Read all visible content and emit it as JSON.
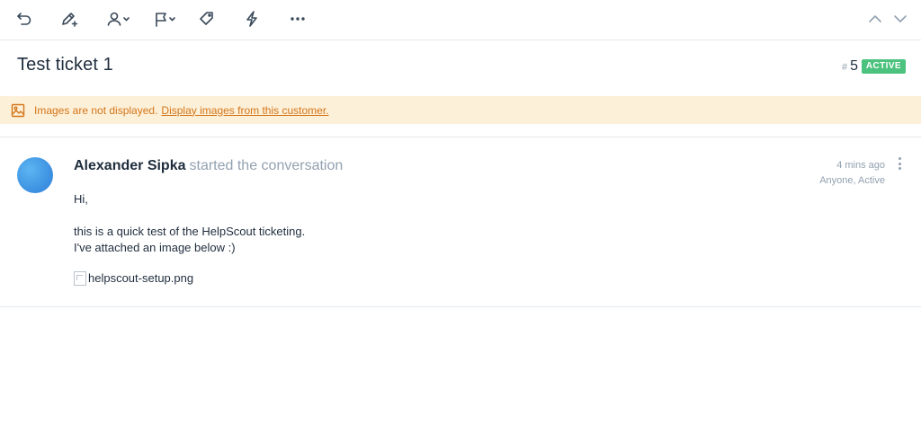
{
  "toolbar": {
    "icons": [
      "undo-icon",
      "edit-note-icon",
      "assign-user-icon",
      "status-flag-icon",
      "tag-icon",
      "workflow-icon",
      "more-icon",
      "previous-arrow-icon",
      "next-arrow-icon"
    ]
  },
  "ticket": {
    "title": "Test ticket 1",
    "hash": "#",
    "number": "5",
    "status": "ACTIVE",
    "status_color": "#4bc27d"
  },
  "banner": {
    "message": "Images are not displayed.",
    "link": "Display images from this customer.",
    "color": "#d37519",
    "background": "#fdf0d8"
  },
  "thread": {
    "author": "Alexander Sipka",
    "action": "started the conversation",
    "time": "4 mins ago",
    "assignee_status": "Anyone, Active",
    "body": {
      "greeting": "Hi,",
      "line1": "this is a quick test of the HelpScout ticketing.",
      "line2": "I've attached an image below :)",
      "attachment_alt": "helpscout-setup.png"
    }
  }
}
